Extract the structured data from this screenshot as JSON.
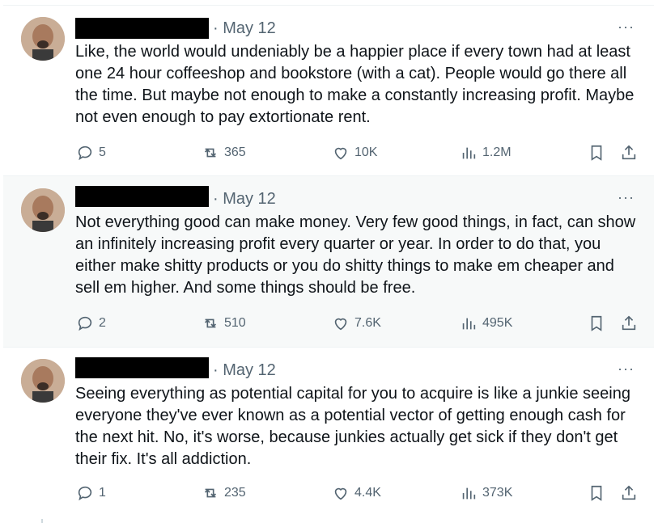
{
  "tweets": [
    {
      "date": "· May 12",
      "more": "···",
      "text": "Like, the world would undeniably be a happier place if every town had at least one 24 hour coffeeshop and bookstore (with a cat). People would go there all the time. But maybe not enough to make a constantly increasing profit. Maybe not even enough to pay extortionate rent.",
      "replies": "5",
      "retweets": "365",
      "likes": "10K",
      "views": "1.2M"
    },
    {
      "date": "· May 12",
      "more": "···",
      "text": "Not everything good can make money. Very few good things, in fact, can show an infinitely increasing profit every quarter or year. In order to do that, you either make shitty products or you do shitty things to make em cheaper and sell em higher. And some things should be free.",
      "replies": "2",
      "retweets": "510",
      "likes": "7.6K",
      "views": "495K"
    },
    {
      "date": "· May 12",
      "more": "···",
      "text": "Seeing everything as potential capital for you to acquire is like a junkie seeing everyone they've ever known as a potential vector of getting enough cash for the next hit. No, it's worse, because junkies actually get sick if they don't get their fix. It's all addiction.",
      "replies": "1",
      "retweets": "235",
      "likes": "4.4K",
      "views": "373K"
    }
  ],
  "colors": {
    "text": "#0f1419",
    "muted": "#536471",
    "thread_line": "#cfd9de",
    "highlight_bg": "#f7f9f9"
  },
  "icons": [
    "reply-icon",
    "retweet-icon",
    "like-icon",
    "views-icon",
    "bookmark-icon",
    "share-icon"
  ]
}
